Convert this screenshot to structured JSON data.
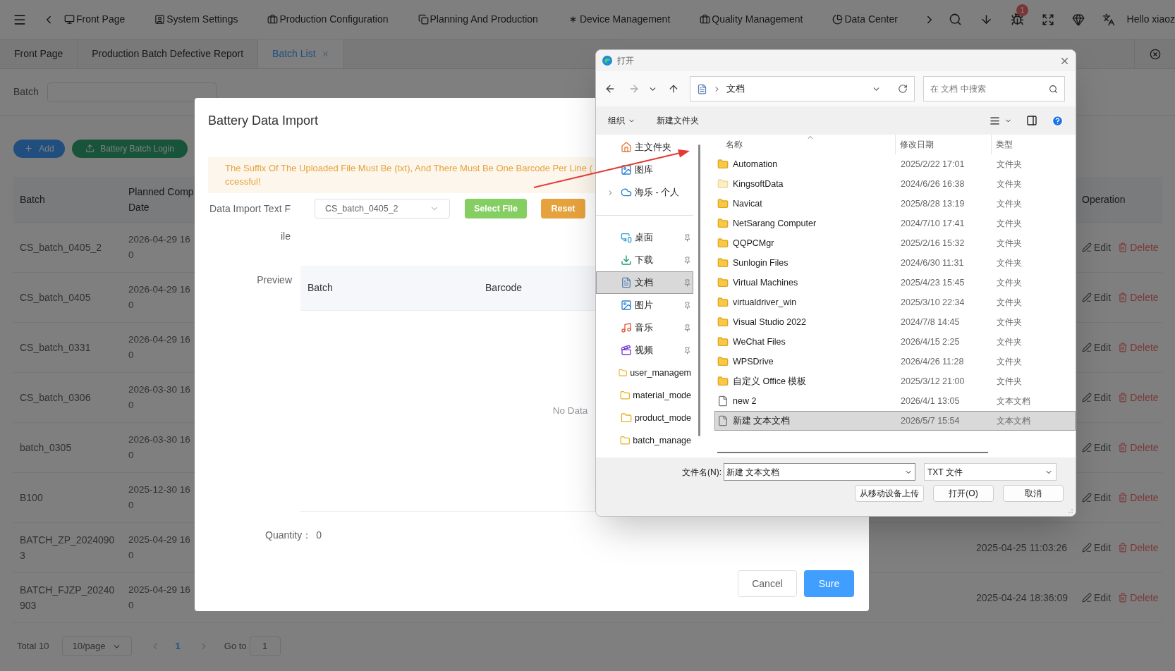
{
  "top_nav": {
    "menu_items": [
      {
        "label": "Front Page"
      },
      {
        "label": "System Settings"
      },
      {
        "label": "Production Configuration"
      },
      {
        "label": "Planning And Production"
      },
      {
        "label": "Device Management"
      },
      {
        "label": "Quality Management"
      },
      {
        "label": "Data Center"
      }
    ],
    "notification_badge": "1",
    "user_greeting": "Hello xiaoz"
  },
  "tabs": [
    {
      "label": "Front Page",
      "selected": false,
      "closable": false
    },
    {
      "label": "Production Batch Defective Report",
      "selected": false,
      "closable": false
    },
    {
      "label": "Batch List",
      "selected": true,
      "closable": true
    }
  ],
  "filter": {
    "label": "Batch"
  },
  "actions": [
    {
      "label": "Add",
      "kind": "primary"
    },
    {
      "label": "Battery Batch Login",
      "kind": "success"
    }
  ],
  "table": {
    "columns": [
      "Batch",
      "Planned Comp\nDate",
      "Operation"
    ],
    "rows": [
      {
        "batch": "CS_batch_0405_2",
        "planned_date": "2026-04-29 16\n0",
        "actions": [
          {
            "label": "Edit",
            "kind": "edit"
          },
          {
            "label": "Delete",
            "kind": "delete"
          }
        ]
      },
      {
        "batch": "CS_batch_0405",
        "planned_date": "2026-04-29 16\n0",
        "actions": [
          {
            "label": "Edit",
            "kind": "edit"
          },
          {
            "label": "Delete",
            "kind": "delete"
          }
        ]
      },
      {
        "batch": "CS_batch_0331",
        "planned_date": "2026-04-29 16\n0",
        "actions": [
          {
            "label": "Edit",
            "kind": "edit"
          },
          {
            "label": "Delete",
            "kind": "delete"
          }
        ]
      },
      {
        "batch": "CS_batch_0306",
        "planned_date": "2026-03-30 16\n0",
        "actions": [
          {
            "label": "Edit",
            "kind": "edit"
          },
          {
            "label": "Delete",
            "kind": "delete"
          }
        ]
      },
      {
        "batch": "batch_0305",
        "planned_date": "2026-03-30 16\n0",
        "actions": [
          {
            "label": "Edit",
            "kind": "edit"
          },
          {
            "label": "Delete",
            "kind": "delete"
          }
        ]
      },
      {
        "batch": "B100",
        "planned_date": "2025-12-30 16\n0",
        "actions": [
          {
            "label": "Edit",
            "kind": "edit"
          },
          {
            "label": "Delete",
            "kind": "delete"
          }
        ]
      },
      {
        "batch": "BATCH_ZP_20240903",
        "planned_date": "2025-04-29 16\n0",
        "time": "2025-04-25 11:03:26",
        "actions": [
          {
            "label": "Edit",
            "kind": "edit"
          },
          {
            "label": "Delete",
            "kind": "delete"
          }
        ]
      },
      {
        "batch": "BATCH_FJZP_20240903",
        "planned_date": "2025-04-29 16\n0",
        "time": "2025-04-24 18:36:09",
        "actions": [
          {
            "label": "Edit",
            "kind": "edit"
          },
          {
            "label": "Delete",
            "kind": "delete"
          }
        ]
      }
    ]
  },
  "pagination": {
    "total": "Total 10",
    "page_size": "10/page",
    "current_page": "1",
    "goto_label": "Go to",
    "goto_value": "1"
  },
  "import_dialog": {
    "title": "Battery Data Import",
    "notice": "The Suffix Of The Uploaded File Must Be (txt), And There Must Be One Barcode Per Line (\nccessful!",
    "file_label": "Data Import Text File",
    "file_value": "CS_batch_0405_2",
    "select_button": "Select File",
    "reset_button": "Reset",
    "preview_label": "Preview",
    "preview_columns": [
      "Batch",
      "Barcode"
    ],
    "empty_text": "No Data",
    "quantity_label": "Quantity：",
    "quantity_value": "0",
    "cancel_button": "Cancel",
    "confirm_button": "Sure"
  },
  "file_dialog": {
    "title": "打开",
    "path": "文档",
    "search_placeholder": "在 文档 中搜索",
    "organize": "组织",
    "new_folder": "新建文件夹",
    "nav_groups": [
      [
        {
          "label": "主文件夹",
          "pinned": false,
          "expandable": false,
          "selected": false
        },
        {
          "label": "图库",
          "pinned": false,
          "expandable": false,
          "selected": false
        },
        {
          "label": "海乐 - 个人",
          "pinned": false,
          "expandable": true,
          "selected": false
        }
      ],
      [
        {
          "label": "桌面",
          "pinned": true,
          "expandable": false,
          "selected": false
        },
        {
          "label": "下载",
          "pinned": true,
          "expandable": false,
          "selected": false
        },
        {
          "label": "文档",
          "pinned": true,
          "expandable": false,
          "selected": true
        },
        {
          "label": "图片",
          "pinned": true,
          "expandable": false,
          "selected": false
        },
        {
          "label": "音乐",
          "pinned": true,
          "expandable": false,
          "selected": false
        },
        {
          "label": "视频",
          "pinned": true,
          "expandable": false,
          "selected": false
        },
        {
          "label": "user_managem",
          "pinned": false,
          "expandable": false,
          "selected": false
        },
        {
          "label": "material_mode",
          "pinned": false,
          "expandable": false,
          "selected": false
        },
        {
          "label": "product_mode",
          "pinned": false,
          "expandable": false,
          "selected": false
        },
        {
          "label": "batch_manage",
          "pinned": false,
          "expandable": false,
          "selected": false
        }
      ]
    ],
    "columns": [
      "名称",
      "修改日期",
      "类型"
    ],
    "files": [
      {
        "name": "Automation",
        "modified": "2025/2/22 17:01",
        "type": "文件夹",
        "kind": "folder",
        "faded": false,
        "selected": false
      },
      {
        "name": "KingsoftData",
        "modified": "2024/6/26 16:38",
        "type": "文件夹",
        "kind": "folder",
        "faded": true,
        "selected": false
      },
      {
        "name": "Navicat",
        "modified": "2025/8/28 13:19",
        "type": "文件夹",
        "kind": "folder",
        "faded": false,
        "selected": false
      },
      {
        "name": "NetSarang Computer",
        "modified": "2024/7/10 17:41",
        "type": "文件夹",
        "kind": "folder",
        "faded": false,
        "selected": false
      },
      {
        "name": "QQPCMgr",
        "modified": "2025/2/16 15:32",
        "type": "文件夹",
        "kind": "folder",
        "faded": false,
        "selected": false
      },
      {
        "name": "Sunlogin Files",
        "modified": "2024/6/30 11:31",
        "type": "文件夹",
        "kind": "folder",
        "faded": false,
        "selected": false
      },
      {
        "name": "Virtual Machines",
        "modified": "2025/4/23 15:45",
        "type": "文件夹",
        "kind": "folder",
        "faded": false,
        "selected": false
      },
      {
        "name": "virtualdriver_win",
        "modified": "2025/3/10 22:34",
        "type": "文件夹",
        "kind": "folder",
        "faded": false,
        "selected": false
      },
      {
        "name": "Visual Studio 2022",
        "modified": "2024/7/8 14:45",
        "type": "文件夹",
        "kind": "folder",
        "faded": false,
        "selected": false
      },
      {
        "name": "WeChat Files",
        "modified": "2026/4/15 2:25",
        "type": "文件夹",
        "kind": "folder",
        "faded": false,
        "selected": false
      },
      {
        "name": "WPSDrive",
        "modified": "2026/4/26 11:28",
        "type": "文件夹",
        "kind": "folder",
        "faded": false,
        "selected": false
      },
      {
        "name": "自定义 Office 模板",
        "modified": "2025/3/12 21:00",
        "type": "文件夹",
        "kind": "folder",
        "faded": false,
        "selected": false
      },
      {
        "name": "new 2",
        "modified": "2026/4/1 13:05",
        "type": "文本文档",
        "kind": "file",
        "faded": false,
        "selected": false
      },
      {
        "name": "新建 文本文档",
        "modified": "2026/5/7 15:54",
        "type": "文本文档",
        "kind": "file",
        "faded": false,
        "selected": true
      }
    ],
    "filename_label": "文件名(N):",
    "filename_value": "新建 文本文档",
    "filter_value": "TXT 文件",
    "upload_button": "从移动设备上传",
    "open_button": "打开(O)",
    "cancel_button": "取消"
  }
}
